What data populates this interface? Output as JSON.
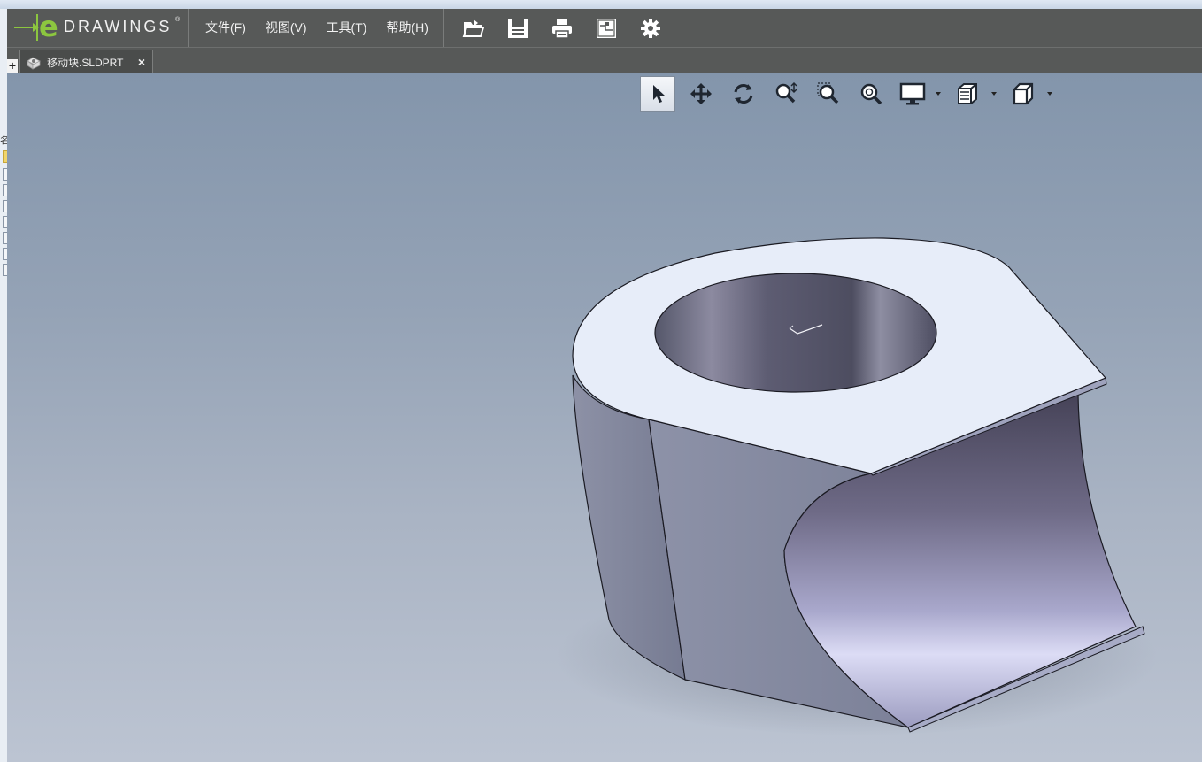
{
  "app": {
    "logo_text": "DRAWINGS",
    "logo_e": "e",
    "logo_mark": "®"
  },
  "menu": [
    {
      "label": "文件(F)"
    },
    {
      "label": "视图(V)"
    },
    {
      "label": "工具(T)"
    },
    {
      "label": "帮助(H)"
    }
  ],
  "toolbar": {
    "icons": [
      "open-icon",
      "save-icon",
      "print-icon",
      "markup-icon",
      "settings-icon"
    ]
  },
  "tabs": {
    "add_label": "+",
    "items": [
      {
        "label": "移动块.SLDPRT",
        "close": "×",
        "icon": "part-icon"
      }
    ]
  },
  "hud": {
    "icons": [
      "select-icon",
      "pan-icon",
      "rotate-icon",
      "zoom-icon",
      "zoom-to-area-icon",
      "zoom-to-fit-icon",
      "display-style-icon",
      "section-icon",
      "view-orientation-icon"
    ]
  },
  "left_edge": {
    "glyph": "名"
  },
  "colors": {
    "menubar": "#575958",
    "accent": "#8cc63f",
    "viewport_top": "#8395ab",
    "viewport_bottom": "#bcc4d2"
  }
}
